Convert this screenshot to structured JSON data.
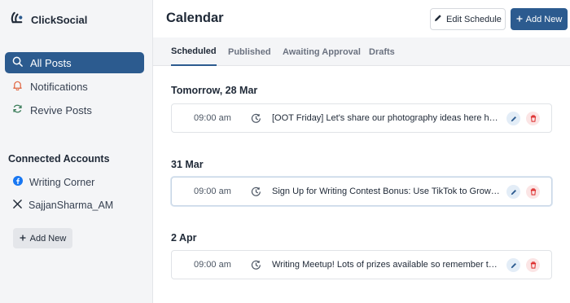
{
  "brand": {
    "name": "ClickSocial"
  },
  "sidebar": {
    "nav": [
      {
        "label": "All Posts",
        "icon": "search-icon",
        "active": true
      },
      {
        "label": "Notifications",
        "icon": "bell-icon",
        "active": false
      },
      {
        "label": "Revive Posts",
        "icon": "refresh-icon",
        "active": false
      }
    ],
    "connected_title": "Connected Accounts",
    "accounts": [
      {
        "label": "Writing Corner",
        "icon": "facebook-icon"
      },
      {
        "label": "SajjanSharma_AM",
        "icon": "x-icon"
      }
    ],
    "add_new_label": "Add New"
  },
  "header": {
    "title": "Calendar",
    "edit_schedule_label": "Edit Schedule",
    "add_new_label": "Add New"
  },
  "tabs": [
    {
      "label": "Scheduled",
      "active": true
    },
    {
      "label": "Published",
      "active": false
    },
    {
      "label": "Awaiting Approval",
      "active": false
    },
    {
      "label": "Drafts",
      "active": false
    }
  ],
  "groups": [
    {
      "date": "Tomorrow, 28 Mar",
      "posts": [
        {
          "time": "09:00 am",
          "text": "[OOT Friday] Let's share our photography ideas here http:..."
        }
      ]
    },
    {
      "date": "31 Mar",
      "posts": [
        {
          "time": "09:00 am",
          "text": "Sign Up for Writing Contest Bonus: Use TikTok to Grow yo..."
        }
      ]
    },
    {
      "date": "2 Apr",
      "posts": [
        {
          "time": "09:00 am",
          "text": "Writing Meetup! Lots of prizes available so remember to s..."
        }
      ]
    }
  ],
  "colors": {
    "accent": "#2c5b8f",
    "sidebar_bg": "#f4f5f7",
    "delete": "#dc2626"
  }
}
